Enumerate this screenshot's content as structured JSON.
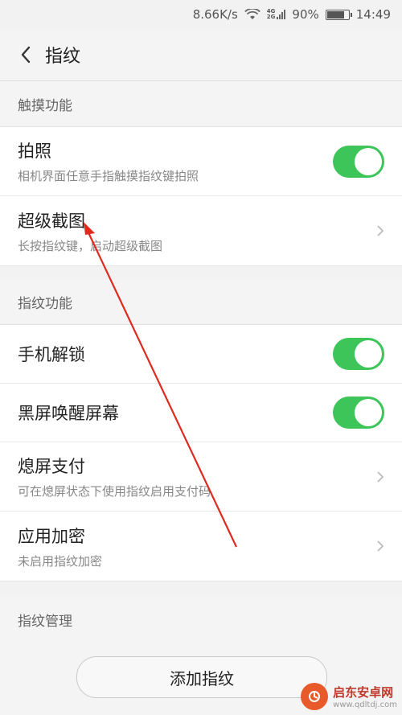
{
  "status_bar": {
    "net_speed": "8.66K/s",
    "signal_tags": [
      "4G",
      "2G"
    ],
    "battery_percent": "90%",
    "battery_level": 0.9,
    "time": "14:49"
  },
  "header": {
    "title": "指纹",
    "back_icon": "chevron-left-icon"
  },
  "section_touch": {
    "label": "触摸功能",
    "rows": [
      {
        "title": "拍照",
        "subtitle": "相机界面任意手指触摸指纹键拍照",
        "control": "toggle",
        "on": true
      },
      {
        "title": "超级截图",
        "subtitle": "长按指纹键，启动超级截图",
        "control": "chevron"
      }
    ]
  },
  "section_fingerprint": {
    "label": "指纹功能",
    "rows": [
      {
        "title": "手机解锁",
        "control": "toggle",
        "on": true
      },
      {
        "title": "黑屏唤醒屏幕",
        "control": "toggle",
        "on": true
      },
      {
        "title": "熄屏支付",
        "subtitle": "可在熄屏状态下使用指纹启用支付码",
        "control": "chevron"
      },
      {
        "title": "应用加密",
        "subtitle": "未启用指纹加密",
        "control": "chevron"
      }
    ]
  },
  "section_manage": {
    "label": "指纹管理"
  },
  "add_button": {
    "label": "添加指纹"
  },
  "watermark": {
    "name": "启东安卓网",
    "url": "www.qdltdj.com"
  },
  "colors": {
    "toggle_on": "#3ec55a",
    "annotation_arrow": "#e02a1f"
  }
}
